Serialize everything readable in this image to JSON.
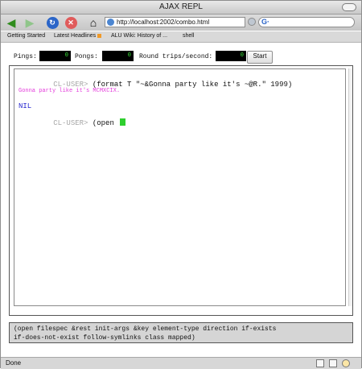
{
  "window": {
    "title": "AJAX REPL"
  },
  "toolbar": {
    "icons": [
      "back-icon",
      "forward-icon",
      "reload-icon",
      "stop-icon",
      "home-icon"
    ],
    "url": "http://localhost:2002/combo.html",
    "search_engine_badge": "G·",
    "search_value": ""
  },
  "bookmarks": [
    {
      "label": "Getting Started"
    },
    {
      "label": "Latest Headlines"
    },
    {
      "label": "ALU Wiki: History of ..."
    },
    {
      "label": "shell"
    }
  ],
  "stats": {
    "pings_label": "Pings:",
    "pings_value": "0",
    "pongs_label": "Pongs:",
    "pongs_value": "0",
    "rts_label": "Round trips/second:",
    "rts_value": "0",
    "start_label": "Start"
  },
  "repl": {
    "prompt1": "CL-USER>",
    "cmd1": "(format T \"~&Gonna party like it's ~@R.\" 1999)",
    "output1": "Gonna party like it's MCMXCIX.",
    "result1": "NIL",
    "prompt2": "CL-USER>",
    "cmd2": "(open "
  },
  "help": {
    "line1": "(open filespec &rest init-args &key element-type direction if-exists",
    "line2": "if-does-not-exist follow-symlinks class mapped)"
  },
  "status": {
    "text": "Done"
  },
  "colors": {
    "prompt": "#a7a7a7",
    "output": "#e43bdb",
    "result": "#2a2ad0",
    "cursor": "#2ecf2e",
    "counter_text": "#37e637"
  }
}
